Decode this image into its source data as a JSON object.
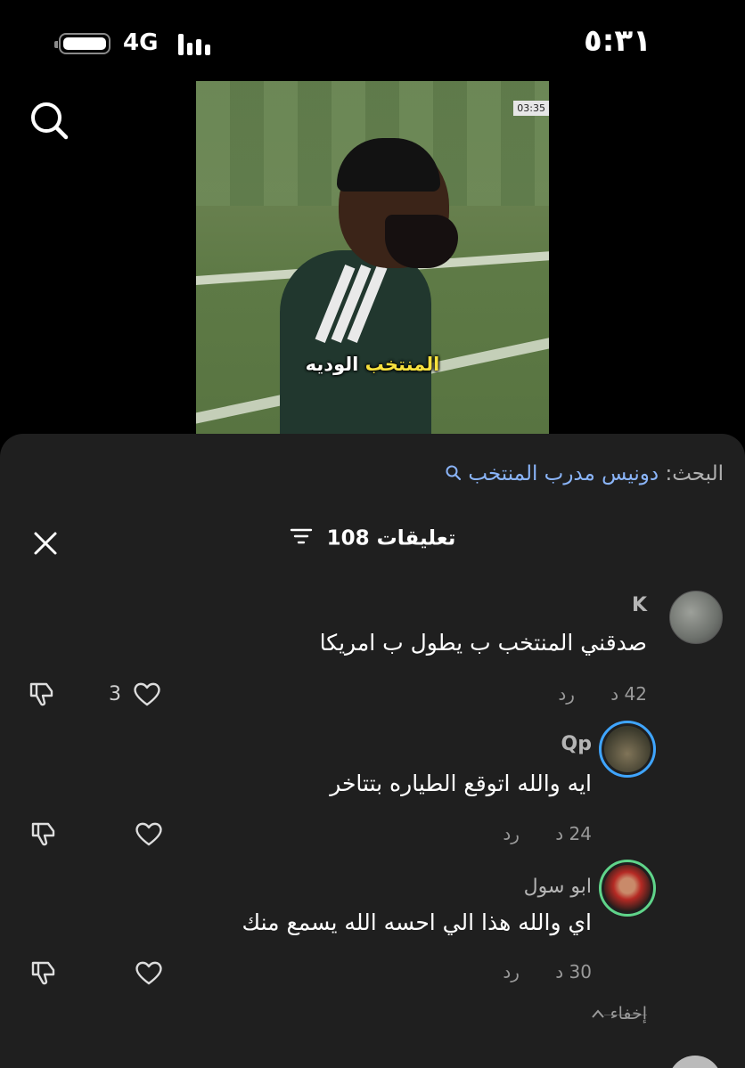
{
  "status_bar": {
    "time": "٥:٣١",
    "network": "4G"
  },
  "video": {
    "caption_highlight": "المنتخب",
    "caption_rest": "الوديه"
  },
  "comments_panel": {
    "search_prefix": "البحث:",
    "search_term": "دونيس مدرب المنتخب",
    "comments_count_label": "108 تعليقات"
  },
  "comments": [
    {
      "username": "K",
      "text": "صدقني المنتخب ب يطول ب امريكا",
      "time": "42 د",
      "reply_label": "رد",
      "likes": "3"
    },
    {
      "username": "Qp",
      "text": "ايه والله اتوقع الطياره بتتاخر",
      "time": "24 د",
      "reply_label": "رد",
      "likes": ""
    },
    {
      "username": "ابو سول",
      "text": "اي والله هذا الي احسه الله يسمع منك",
      "time": "30 د",
      "reply_label": "رد",
      "likes": ""
    }
  ],
  "replies": {
    "hide_label": "إخفاء"
  },
  "icons": {
    "search": "search-icon",
    "close": "close-icon",
    "sort": "sort-icon",
    "like": "heart-icon",
    "dislike": "thumbs-down-icon"
  }
}
